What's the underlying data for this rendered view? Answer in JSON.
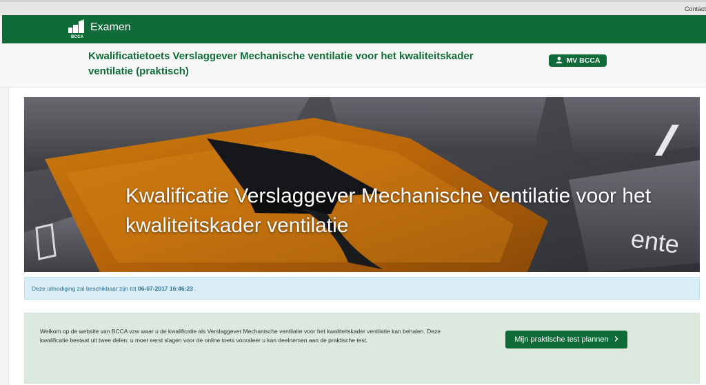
{
  "topbar": {
    "contact_label": "Contact"
  },
  "navbar": {
    "brand_name": "Examen",
    "logo_text": "BCCA"
  },
  "header": {
    "page_title": "Kwalificatietoets Verslaggever Mechanische ventilatie voor het kwaliteitskader ventilatie (praktisch)",
    "badge_label": "MV BCCA",
    "badge_icon": "user-icon"
  },
  "hero": {
    "title": "Kwalificatie Verslaggever Mechanische ventilatie voor het kwaliteitskader ventilatie"
  },
  "alert": {
    "text_before": "Deze uitnodiging zal beschikbaar zijn tot ",
    "date": "06-07-2017 16:46:23",
    "text_after": " ."
  },
  "welcome": {
    "text": "Welkom op de website van BCCA vzw waar u de kwalificatie als Verslaggever Mechanische ventilatie voor het kwaliteitskader ventilatie kan behalen. Deze kwalificatie bestaat uit twee delen: u moet eerst slagen voor de online toets vooraleer u kan deelnemen aan de praktische test.",
    "button_label": "Mijn praktische test plannen",
    "button_icon": "chevron-right-icon"
  },
  "colors": {
    "brand_green": "#0f6b37",
    "alert_bg": "#d8edf6",
    "welcome_bg": "#dbe9df"
  }
}
